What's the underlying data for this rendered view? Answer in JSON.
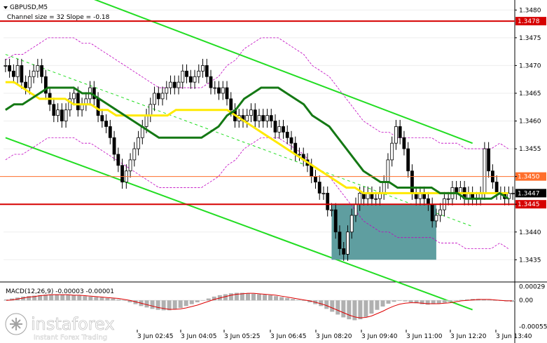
{
  "header": {
    "symbol": "GBPUSD,M5",
    "channel_info": "Channel size = 32 Slope = -0.18"
  },
  "colors": {
    "resistance": "#d60000",
    "level_1450": "#ff6f2c",
    "ma_fast": "#ffea00",
    "ma_slow": "#147814",
    "channel": "#22dd22",
    "envelope": "#c000c0",
    "candle": "#000000",
    "box": "#5f9ea0",
    "macd_hist": "#b0b0b0",
    "macd_signal": "#dd0000"
  },
  "chart_data": [
    {
      "type": "candlestick",
      "title": "GBPUSD,M5",
      "subtitle": "Channel size = 32 Slope = -0.18",
      "y_ticks": [
        1.348,
        1.3475,
        1.347,
        1.3465,
        1.346,
        1.3455,
        1.345,
        1.3445,
        1.344,
        1.3435
      ],
      "y_tick_labels": [
        "1.3480",
        "1.3475",
        "1.3470",
        "1.3465",
        "1.3460",
        "1.3455",
        "1.3450",
        "1.3445",
        "1.3440",
        "1.3435"
      ],
      "ylim": [
        1.34315,
        1.34813
      ],
      "x_tick_labels": [
        "3 Jun 02:45",
        "3 Jun 04:05",
        "3 Jun 05:25",
        "3 Jun 06:45",
        "3 Jun 08:20",
        "3 Jun 09:40",
        "3 Jun 11:00",
        "3 Jun 12:20",
        "3 Jun 13:40"
      ],
      "levels": [
        {
          "value": 1.3478,
          "label": "1.3478",
          "role": "resistance"
        },
        {
          "value": 1.345,
          "label": "1.3450",
          "role": "level_1450"
        },
        {
          "value": 1.3445,
          "label": "1.3445",
          "role": "resistance"
        }
      ],
      "current_price": {
        "value": 1.3447,
        "label": "1.3447"
      },
      "channel": {
        "upper": [
          [
            0,
            1.3488
          ],
          [
            116,
            1.3456
          ]
        ],
        "middle": [
          [
            0,
            1.3472
          ],
          [
            116,
            1.3441
          ]
        ],
        "lower": [
          [
            0,
            1.3457
          ],
          [
            116,
            1.3426
          ]
        ]
      },
      "highlight_box": {
        "x_from": 81,
        "x_to": 107,
        "y_from": 1.3435,
        "y_to": 1.3445
      },
      "series": [
        {
          "name": "close",
          "values": [
            1.347,
            1.3469,
            1.3468,
            1.347,
            1.3467,
            1.3466,
            1.3468,
            1.3469,
            1.347,
            1.3468,
            1.3465,
            1.3463,
            1.3461,
            1.3462,
            1.346,
            1.3462,
            1.3464,
            1.3465,
            1.3462,
            1.3463,
            1.3464,
            1.3466,
            1.3464,
            1.3461,
            1.346,
            1.3459,
            1.3457,
            1.3454,
            1.3452,
            1.3449,
            1.3451,
            1.3453,
            1.3455,
            1.3457,
            1.3459,
            1.3461,
            1.3463,
            1.3465,
            1.3464,
            1.3465,
            1.3466,
            1.3467,
            1.3466,
            1.3467,
            1.3469,
            1.3468,
            1.3467,
            1.3468,
            1.3469,
            1.347,
            1.3468,
            1.3466,
            1.3466,
            1.3465,
            1.3466,
            1.3464,
            1.3462,
            1.346,
            1.3461,
            1.346,
            1.3461,
            1.3462,
            1.346,
            1.3461,
            1.346,
            1.3461,
            1.346,
            1.3458,
            1.3459,
            1.3458,
            1.3457,
            1.3456,
            1.3454,
            1.3454,
            1.3453,
            1.3452,
            1.345,
            1.3449,
            1.3447,
            1.3447,
            1.3444,
            1.3444,
            1.344,
            1.3437,
            1.3436,
            1.344,
            1.3443,
            1.3445,
            1.3447,
            1.3446,
            1.3447,
            1.3446,
            1.3446,
            1.3447,
            1.3449,
            1.3453,
            1.3456,
            1.3459,
            1.3457,
            1.3455,
            1.3451,
            1.3447,
            1.3446,
            1.3447,
            1.3446,
            1.3445,
            1.3442,
            1.3443,
            1.3444,
            1.3446,
            1.3446,
            1.3448,
            1.3447,
            1.3448,
            1.3446,
            1.3447,
            1.3446,
            1.3446,
            1.3447,
            1.3455,
            1.3451,
            1.3449,
            1.3447,
            1.3447,
            1.3446,
            1.3447,
            1.3447
          ]
        },
        {
          "name": "ma_slow",
          "values": [
            1.3462,
            1.3463,
            1.3463,
            1.3464,
            1.3465,
            1.3466,
            1.3466,
            1.3466,
            1.3466,
            1.3465,
            1.3465,
            1.3464,
            1.3463,
            1.3462,
            1.3461,
            1.346,
            1.3459,
            1.3458,
            1.3457,
            1.3457,
            1.3457,
            1.3457,
            1.3457,
            1.3457,
            1.3458,
            1.3459,
            1.3461,
            1.3462,
            1.3464,
            1.3465,
            1.3466,
            1.3466,
            1.3466,
            1.3465,
            1.3464,
            1.3463,
            1.3461,
            1.346,
            1.3459,
            1.3457,
            1.3455,
            1.3453,
            1.3451,
            1.345,
            1.3449,
            1.3449,
            1.3448,
            1.3448,
            1.3448,
            1.3448,
            1.3448,
            1.3447,
            1.3447,
            1.3447,
            1.3446,
            1.3446,
            1.3446,
            1.3446,
            1.3447,
            1.3446
          ]
        },
        {
          "name": "ma_fast",
          "values": [
            1.3467,
            1.3467,
            1.3466,
            1.3465,
            1.3464,
            1.3464,
            1.3464,
            1.3464,
            1.3463,
            1.3463,
            1.3463,
            1.3462,
            1.3462,
            1.3461,
            1.3461,
            1.3461,
            1.3461,
            1.3461,
            1.3461,
            1.3461,
            1.3462,
            1.3462,
            1.3462,
            1.3462,
            1.3462,
            1.3462,
            1.3462,
            1.3461,
            1.346,
            1.3459,
            1.3458,
            1.3457,
            1.3456,
            1.3455,
            1.3454,
            1.3453,
            1.3452,
            1.3451,
            1.345,
            1.3449,
            1.3448,
            1.3448,
            1.3447,
            1.3447,
            1.3447,
            1.3447,
            1.3447,
            1.3447,
            1.3447,
            1.3447,
            1.3447,
            1.3447,
            1.3447,
            1.3447,
            1.3447,
            1.3447,
            1.3447,
            1.3447,
            1.3447,
            1.3447
          ]
        }
      ]
    },
    {
      "type": "bar",
      "title": "MACD(12,26,9) -0.00003 -0.00001",
      "y_ticks": [
        0.00029,
        0.0,
        -0.00055
      ],
      "y_tick_labels": [
        "0.00029",
        "0.00",
        "-0.00055"
      ],
      "ylim": [
        -0.00062,
        0.00036
      ],
      "series": [
        {
          "name": "MACD",
          "values": [
            2e-05,
            4e-05,
            6e-05,
            8e-05,
            9e-05,
            0.0001,
            0.00011,
            0.00012,
            0.00013,
            0.00013,
            0.00012,
            0.00012,
            0.00011,
            0.0001,
            9e-05,
            8e-05,
            7e-05,
            6e-05,
            5e-05,
            4e-05,
            2e-05,
            -1e-05,
            -4e-05,
            -8e-05,
            -0.00012,
            -0.00015,
            -0.00018,
            -0.0002,
            -0.00021,
            -0.00021,
            -0.00019,
            -0.00016,
            -0.00012,
            -8e-05,
            -4e-05,
            0.0,
            4e-05,
            8e-05,
            0.00011,
            0.00013,
            0.00015,
            0.00016,
            0.00016,
            0.00015,
            0.00014,
            0.00013,
            0.00012,
            0.00011,
            9e-05,
            7e-05,
            5e-05,
            3e-05,
            1e-05,
            -1e-05,
            -4e-05,
            -8e-05,
            -0.00012,
            -0.00018,
            -0.00024,
            -0.0003,
            -0.00036,
            -0.0004,
            -0.00042,
            -0.0004,
            -0.00035,
            -0.00028,
            -0.0002,
            -0.00013,
            -7e-05,
            -3e-05,
            -1e-05,
            -2e-05,
            -4e-05,
            -6e-05,
            -8e-05,
            -9e-05,
            -8e-05,
            -7e-05,
            -5e-05,
            -3e-05,
            -1e-05,
            1e-05,
            2e-05,
            3e-05,
            3e-05,
            2e-05,
            1e-05,
            0.0,
            -1e-05,
            -2e-05,
            -3e-05
          ]
        },
        {
          "name": "Signal",
          "values": [
            0.0,
            1e-05,
            3e-05,
            5e-05,
            7e-05,
            8e-05,
            0.0001,
            0.00011,
            0.00012,
            0.00012,
            0.00012,
            0.00012,
            0.00011,
            0.00011,
            0.0001,
            9e-05,
            8e-05,
            7e-05,
            6e-05,
            5e-05,
            4e-05,
            2e-05,
            0.0,
            -3e-05,
            -6e-05,
            -9e-05,
            -0.00012,
            -0.00015,
            -0.00017,
            -0.00019,
            -0.00019,
            -0.00018,
            -0.00016,
            -0.00013,
            -0.0001,
            -6e-05,
            -2e-05,
            2e-05,
            5e-05,
            8e-05,
            0.00011,
            0.00013,
            0.00014,
            0.00015,
            0.00015,
            0.00014,
            0.00013,
            0.00012,
            0.00011,
            9e-05,
            7e-05,
            5e-05,
            3e-05,
            1e-05,
            -1e-05,
            -4e-05,
            -7e-05,
            -0.00011,
            -0.00016,
            -0.00021,
            -0.00026,
            -0.00031,
            -0.00035,
            -0.00037,
            -0.00036,
            -0.00033,
            -0.00028,
            -0.00023,
            -0.00017,
            -0.00012,
            -8e-05,
            -6e-05,
            -5e-05,
            -5e-05,
            -6e-05,
            -7e-05,
            -7e-05,
            -7e-05,
            -6e-05,
            -5e-05,
            -3e-05,
            -1e-05,
            0.0,
            1e-05,
            2e-05,
            2e-05,
            2e-05,
            1e-05,
            0.0,
            -1e-05,
            -1e-05
          ]
        }
      ]
    }
  ],
  "watermark": {
    "brand": "instaforex",
    "tagline": "Instant Forex Trading"
  }
}
